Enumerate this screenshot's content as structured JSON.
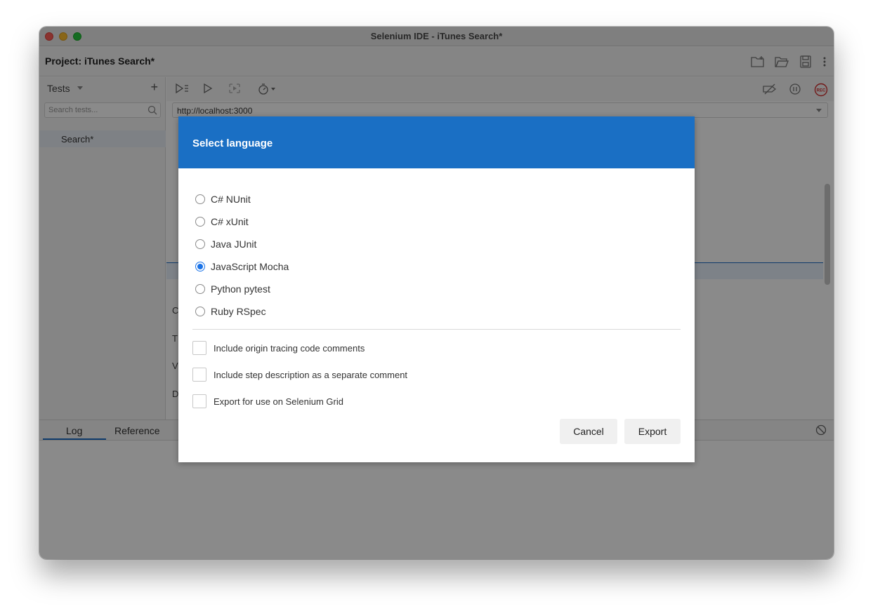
{
  "window": {
    "title": "Selenium IDE - iTunes Search*"
  },
  "project": {
    "label": "Project:",
    "name": "iTunes Search*"
  },
  "tests": {
    "heading": "Tests",
    "search_placeholder": "Search tests...",
    "items": [
      "Search*"
    ]
  },
  "url": {
    "value": "http://localhost:3000"
  },
  "background_letters": [
    "C",
    "T",
    "V",
    "D"
  ],
  "bottom_tabs": [
    "Log",
    "Reference"
  ],
  "dialog": {
    "title": "Select language",
    "languages": [
      {
        "label": "C# NUnit",
        "selected": false
      },
      {
        "label": "C# xUnit",
        "selected": false
      },
      {
        "label": "Java JUnit",
        "selected": false
      },
      {
        "label": "JavaScript Mocha",
        "selected": true
      },
      {
        "label": "Python pytest",
        "selected": false
      },
      {
        "label": "Ruby RSpec",
        "selected": false
      }
    ],
    "options": [
      {
        "label": "Include origin tracing code comments",
        "checked": false
      },
      {
        "label": "Include step description as a separate comment",
        "checked": false
      },
      {
        "label": "Export for use on Selenium Grid",
        "checked": false
      }
    ],
    "cancel_label": "Cancel",
    "export_label": "Export"
  },
  "colors": {
    "dialog_header": "#1a6fc4",
    "radio_selected": "#1a73e8",
    "record_button": "#d32f2f"
  }
}
